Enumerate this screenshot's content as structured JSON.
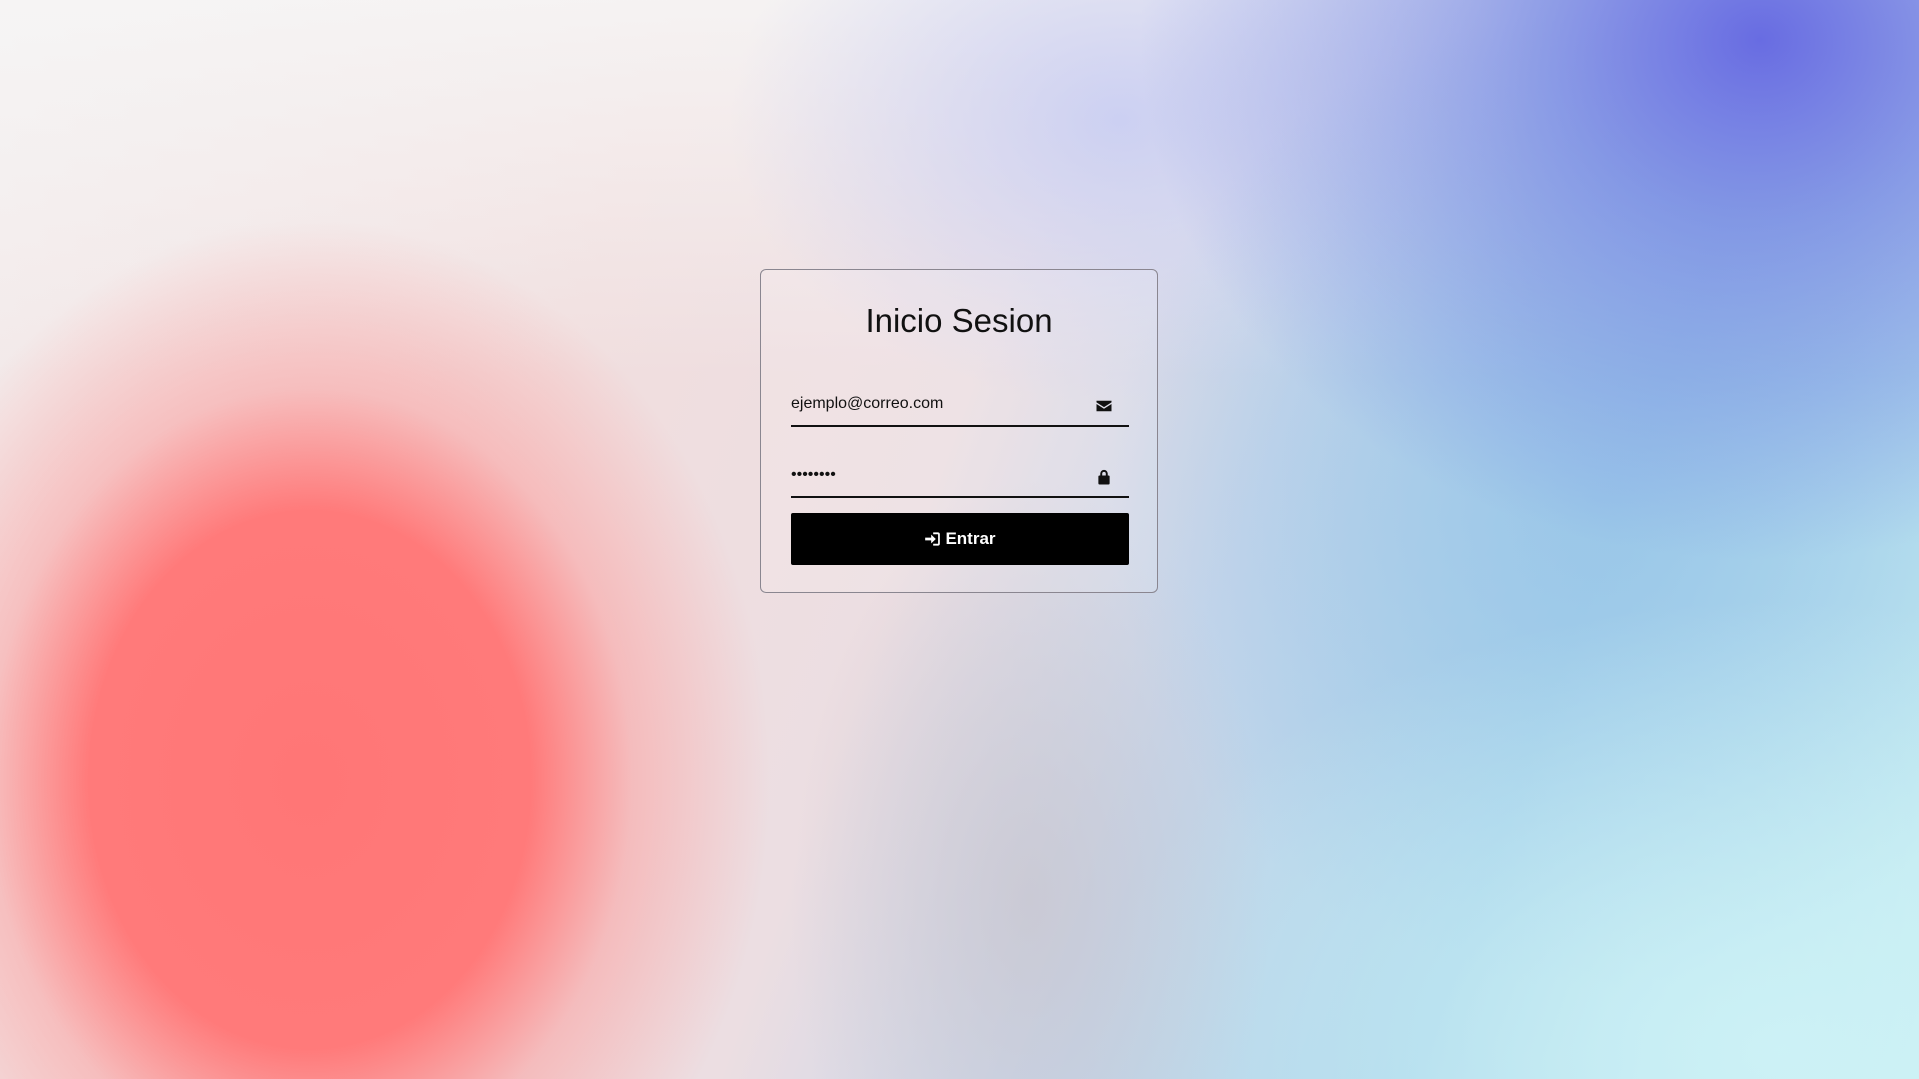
{
  "login": {
    "title": "Inicio Sesion",
    "email_value": "ejemplo@correo.com",
    "password_value": "12345678",
    "submit_label": "Entrar"
  },
  "icons": {
    "email": "envelope-icon",
    "password": "lock-icon",
    "submit": "sign-in-icon"
  },
  "colors": {
    "button_bg": "#000000",
    "button_text": "#ffffff",
    "text": "#111111"
  }
}
